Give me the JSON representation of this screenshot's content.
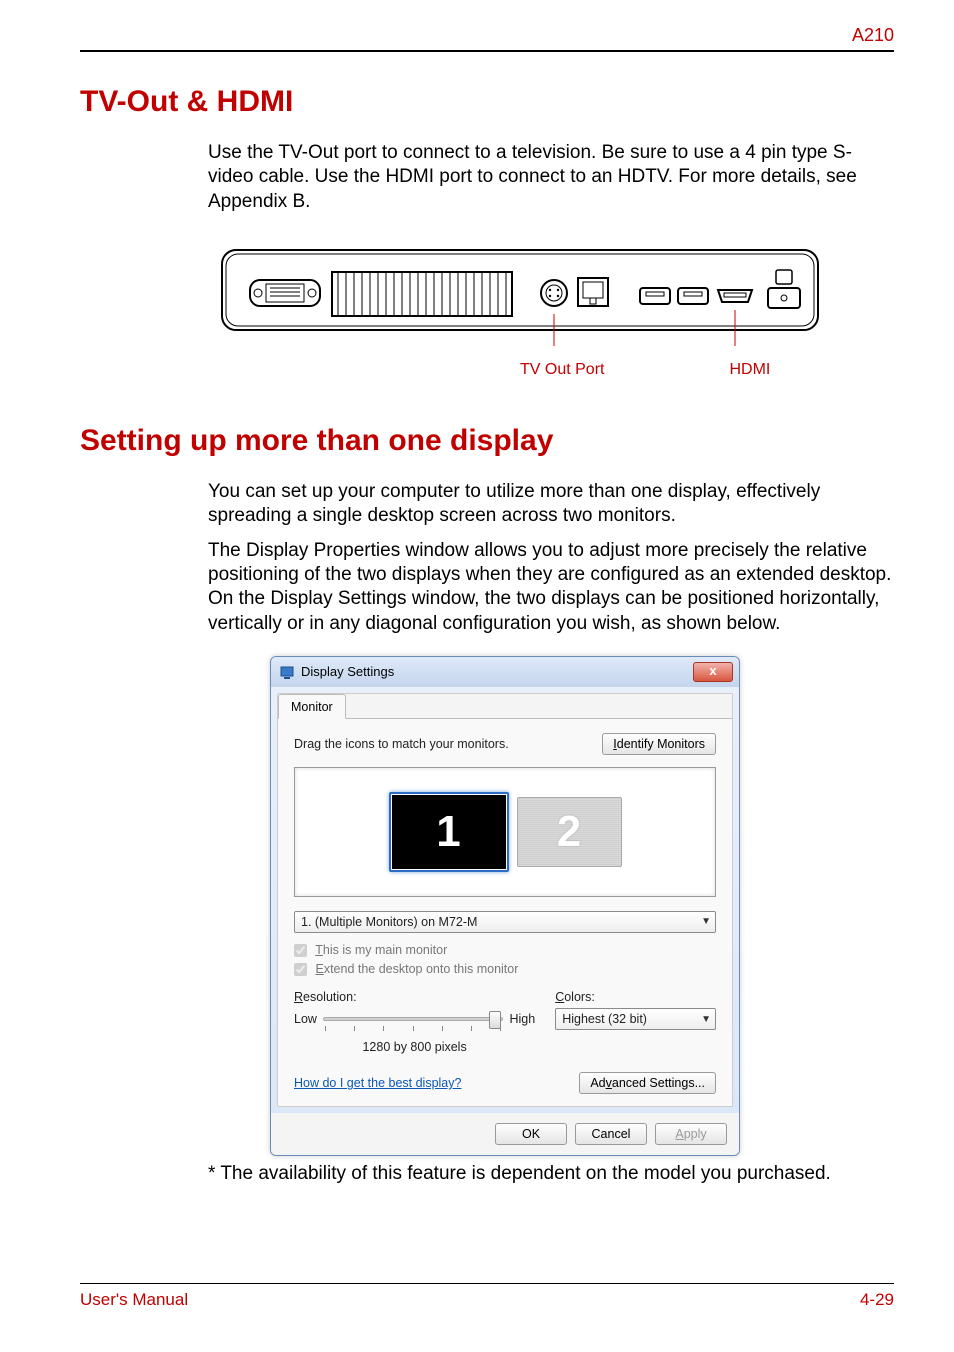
{
  "header": {
    "model": "A210"
  },
  "section1": {
    "title": "TV-Out & HDMI",
    "para": "Use the TV-Out port to connect to a television. Be sure to use a 4 pin type S-video cable. Use the HDMI port to connect to an HDTV. For more details, see Appendix B.",
    "label_tvout": "TV Out Port",
    "label_hdmi": "HDMI"
  },
  "section2": {
    "title": "Setting up more than one display",
    "para1": "You can set up your computer to utilize more than one display, effectively spreading a single desktop screen across two monitors.",
    "para2": "The Display Properties window allows you to adjust more precisely the relative positioning of the two displays when they are configured as an extended desktop. On the Display Settings window, the two displays can be positioned horizontally, vertically or in any diagonal configuration you wish, as shown below.",
    "note": "* The availability of this feature is dependent on the model you purchased."
  },
  "dialog": {
    "title": "Display Settings",
    "close": "x",
    "tab": "Monitor",
    "instruction": "Drag the icons to match your monitors.",
    "identify": "Identify Monitors",
    "mon1": "1",
    "mon2": "2",
    "monitor_select": "1. (Multiple Monitors) on M72-M",
    "chk_main_pre": "T",
    "chk_main_rest": "his is my main monitor",
    "chk_ext_pre": "E",
    "chk_ext_rest": "xtend the desktop onto this monitor",
    "res_label_pre": "R",
    "res_label_rest": "esolution:",
    "color_label_pre": "C",
    "color_label_rest": "olors:",
    "low": "Low",
    "high": "High",
    "res_value": "1280 by 800 pixels",
    "color_value": "Highest (32 bit)",
    "help": "How do I get the best display?",
    "adv_pre": "Ad",
    "adv_u": "v",
    "adv_post": "anced Settings...",
    "ok": "OK",
    "cancel": "Cancel",
    "apply_pre": "A",
    "apply_rest": "pply"
  },
  "footer": {
    "left": "User's Manual",
    "right": "4-29"
  }
}
